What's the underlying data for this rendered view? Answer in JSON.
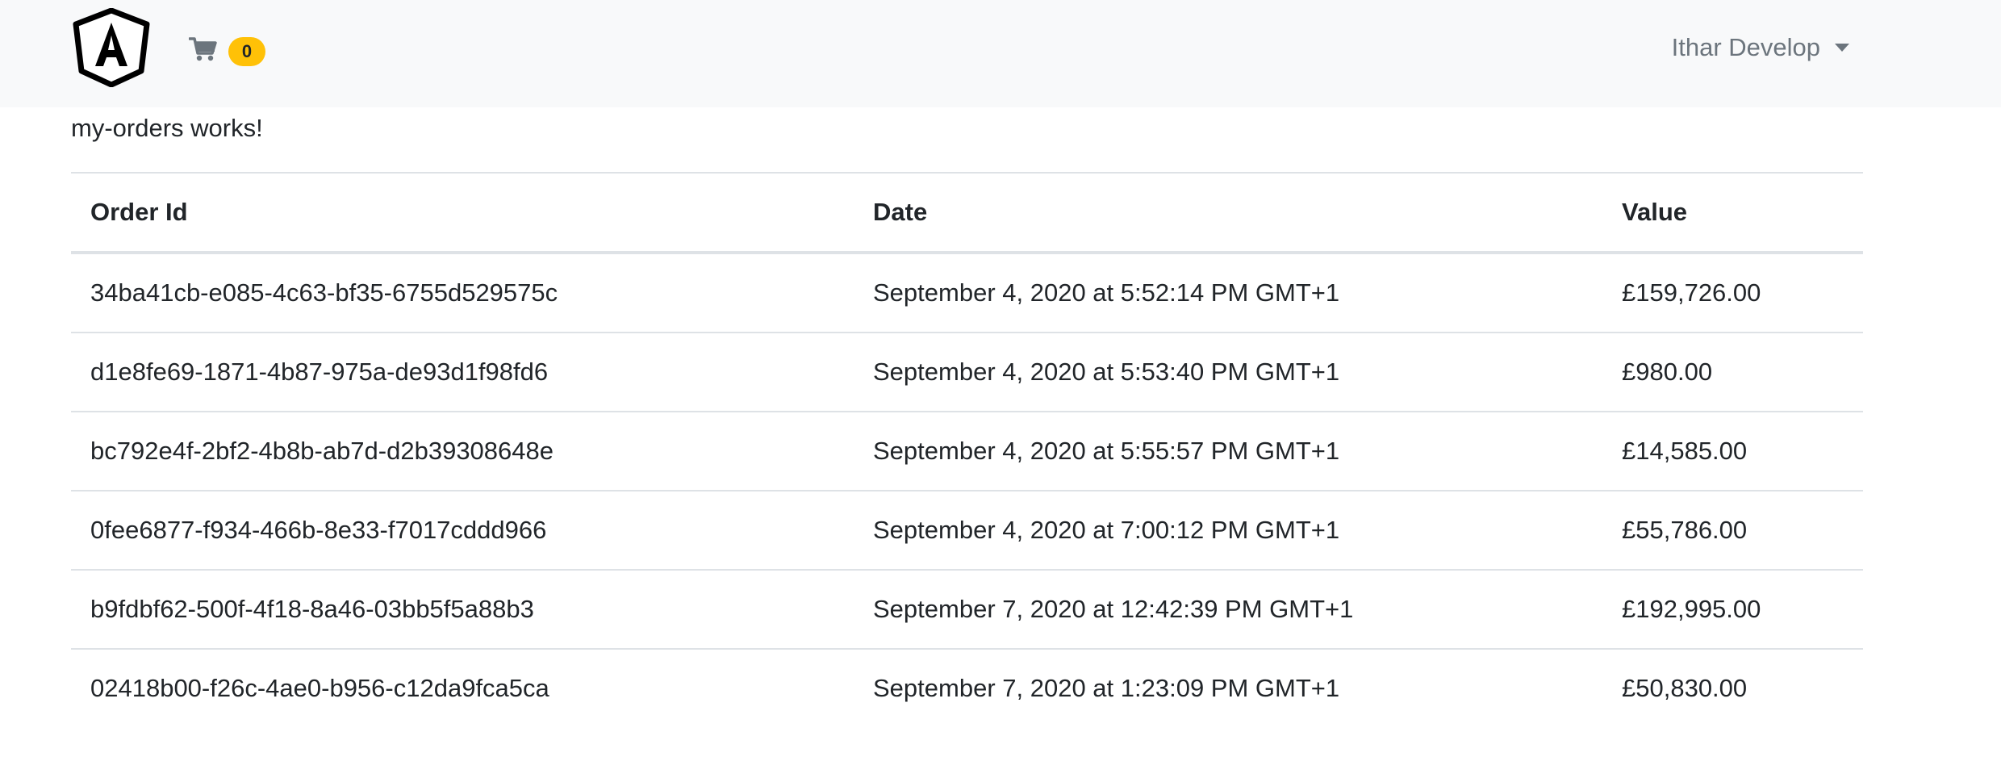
{
  "navbar": {
    "brand_icon": "angular-logo-icon",
    "cart_icon": "shopping-cart-icon",
    "cart_count": "0",
    "user_name": "Ithar Develop",
    "dropdown_icon": "caret-down-icon"
  },
  "page": {
    "message": "my-orders works!"
  },
  "orders_table": {
    "headers": [
      "Order Id",
      "Date",
      "Value"
    ],
    "rows": [
      {
        "id": "34ba41cb-e085-4c63-bf35-6755d529575c",
        "date": "September 4, 2020 at 5:52:14 PM GMT+1",
        "value": "£159,726.00"
      },
      {
        "id": "d1e8fe69-1871-4b87-975a-de93d1f98fd6",
        "date": "September 4, 2020 at 5:53:40 PM GMT+1",
        "value": "£980.00"
      },
      {
        "id": "bc792e4f-2bf2-4b8b-ab7d-d2b39308648e",
        "date": "September 4, 2020 at 5:55:57 PM GMT+1",
        "value": "£14,585.00"
      },
      {
        "id": "0fee6877-f934-466b-8e33-f7017cddd966",
        "date": "September 4, 2020 at 7:00:12 PM GMT+1",
        "value": "£55,786.00"
      },
      {
        "id": "b9fdbf62-500f-4f18-8a46-03bb5f5a88b3",
        "date": "September 7, 2020 at 12:42:39 PM GMT+1",
        "value": "£192,995.00"
      },
      {
        "id": "02418b00-f26c-4ae0-b956-c12da9fca5ca",
        "date": "September 7, 2020 at 1:23:09 PM GMT+1",
        "value": "£50,830.00"
      }
    ]
  },
  "colors": {
    "navbar_bg": "#f8f9fa",
    "badge_bg": "#ffc107",
    "muted_text": "#6c757d",
    "border": "#dee2e6"
  }
}
